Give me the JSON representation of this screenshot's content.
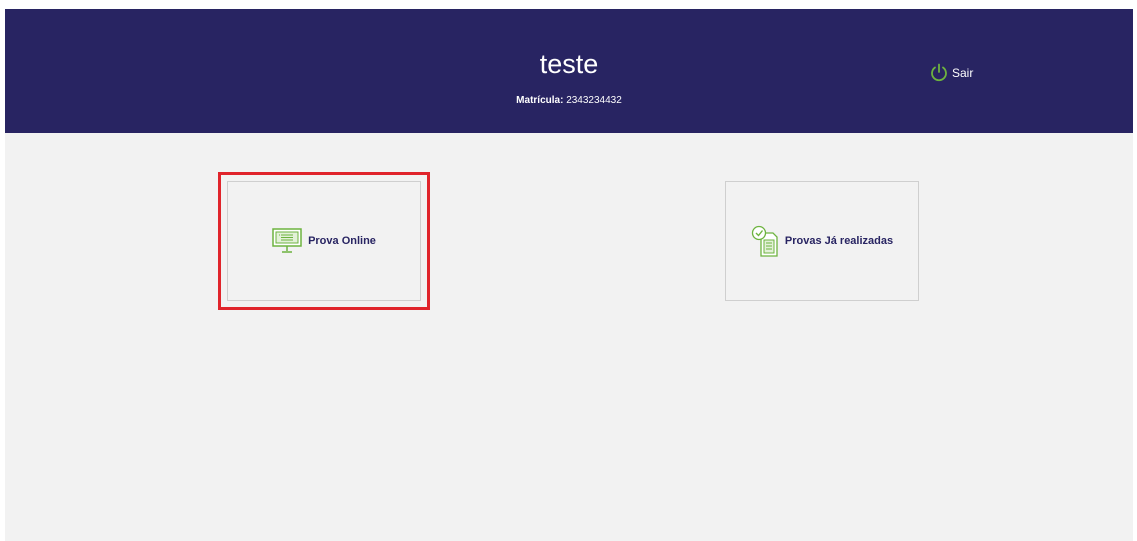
{
  "header": {
    "user_name": "teste",
    "matricula_label": "Matrícula:",
    "matricula_value": "2343234432",
    "logout_label": "Sair",
    "logout_icon": "power-icon"
  },
  "cards": [
    {
      "label": "Prova Online",
      "icon": "monitor-icon",
      "selected": true
    },
    {
      "label": "Provas Já realizadas",
      "icon": "checked-document-icon",
      "selected": false
    }
  ],
  "colors": {
    "header_bg": "#282462",
    "page_bg": "#f2f2f2",
    "icon_green": "#6db33f",
    "label_text": "#282462",
    "highlight_red": "#e0242b"
  }
}
